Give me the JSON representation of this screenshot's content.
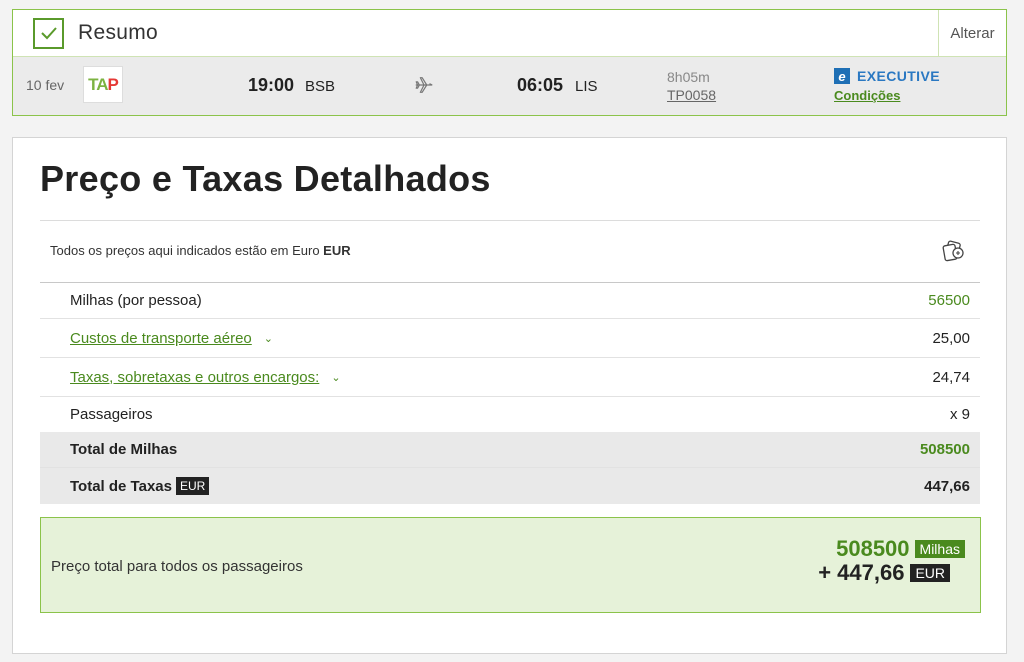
{
  "summary": {
    "title": "Resumo",
    "alter_label": "Alterar"
  },
  "flight": {
    "date": "10 fev",
    "airline_logo": "TAP",
    "airline_logo_parts": [
      "TA",
      "P"
    ],
    "departure_time": "19:00",
    "departure_code": "BSB",
    "arrival_time": "06:05",
    "arrival_code": "LIS",
    "duration": "8h05m",
    "flight_number": "TP0058",
    "class_icon_letter": "e",
    "class_name": "EXECUTIVE",
    "conditions_label": "Condições"
  },
  "detail": {
    "title": "Preço e Taxas Detalhados",
    "currency_note_prefix": "Todos os preços aqui indicados estão em Euro",
    "currency_note_code": "EUR",
    "rows": [
      {
        "label": "Milhas (por pessoa)",
        "value": "56500"
      },
      {
        "label": "Custos de transporte aéreo",
        "value": "25,00"
      },
      {
        "label": "Taxas, sobretaxas e outros encargos:",
        "value": "24,74"
      },
      {
        "label": "Passageiros",
        "value": "x 9"
      }
    ],
    "total_miles_label": "Total de Milhas",
    "total_miles_value": "508500",
    "total_taxes_label": "Total de Taxas",
    "total_taxes_currency": "EUR",
    "total_taxes_value": "447,66"
  },
  "grand_total": {
    "label": "Preço total para todos os passageiros",
    "miles_value": "508500",
    "miles_unit": "Milhas",
    "eur_value": "+ 447,66",
    "eur_unit": "EUR"
  },
  "colors": {
    "accent_green": "#4a8a1e",
    "border_green": "#8bc34a",
    "executive_blue": "#2a78c2",
    "tap_red": "#e53935"
  }
}
